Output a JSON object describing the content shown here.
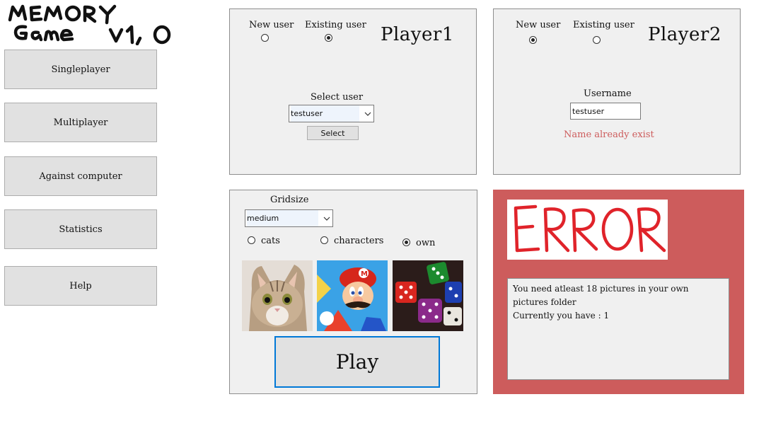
{
  "logo": {
    "line1": "MEMORY",
    "line2": "Game v1.0"
  },
  "sidebar": {
    "items": [
      {
        "label": "Singleplayer"
      },
      {
        "label": "Multiplayer"
      },
      {
        "label": "Against computer"
      },
      {
        "label": "Statistics"
      },
      {
        "label": "Help"
      }
    ]
  },
  "player1": {
    "title": "Player1",
    "new_user_label": "New user",
    "existing_user_label": "Existing user",
    "selected_mode": "existing",
    "select_user_label": "Select user",
    "select_user_value": "testuser",
    "select_button": "Select"
  },
  "player2": {
    "title": "Player2",
    "new_user_label": "New user",
    "existing_user_label": "Existing user",
    "selected_mode": "new",
    "username_label": "Username",
    "username_value": "testuser",
    "message": "Name already exist",
    "message_color": "#cd5c5c"
  },
  "settings": {
    "gridsize_label": "Gridsize",
    "gridsize_value": "medium",
    "themes": [
      {
        "label": "cats",
        "selected": false
      },
      {
        "label": "characters",
        "selected": false
      },
      {
        "label": "own",
        "selected": true
      }
    ],
    "thumbnails": [
      "cat-image",
      "mario-image",
      "dice-image"
    ],
    "play_label": "Play"
  },
  "error": {
    "image_text": "ERROR",
    "message_line1": "You need atleast 18 pictures in your own",
    "message_line2": "pictures folder",
    "message_line3": "Currently you have : 1",
    "panel_color": "#cd5c5c"
  },
  "colors": {
    "accent": "#0078d7",
    "panel_bg": "#f0f0f0",
    "button_bg": "#e1e1e1"
  }
}
